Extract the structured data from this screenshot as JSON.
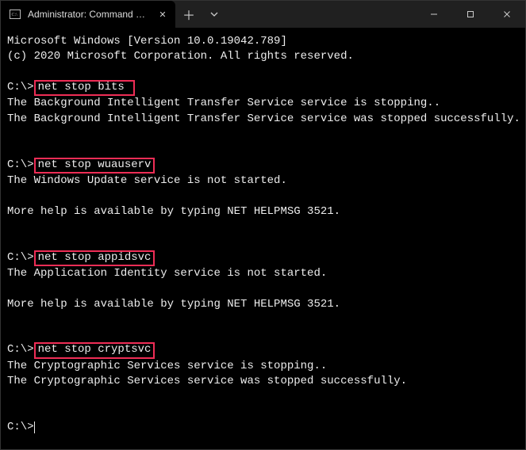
{
  "titlebar": {
    "tab_title": "Administrator: Command Promp",
    "tab_close_glyph": "✕",
    "new_tab_glyph": "＋",
    "dropdown_glyph": "⌄"
  },
  "win_controls": {
    "min_tooltip": "Minimize",
    "max_tooltip": "Maximize",
    "close_tooltip": "Close"
  },
  "terminal": {
    "line_os": "Microsoft Windows [Version 10.0.19042.789]",
    "line_copyright": "(c) 2020 Microsoft Corporation. All rights reserved.",
    "prompt": "C:\\>",
    "cmd1": "net stop bits",
    "cmd1_trail": " ",
    "out1a": "The Background Intelligent Transfer Service service is stopping..",
    "out1b": "The Background Intelligent Transfer Service service was stopped successfully.",
    "cmd2": "net stop wuauserv",
    "out2a": "The Windows Update service is not started.",
    "out2b": "More help is available by typing NET HELPMSG 3521.",
    "cmd3": "net stop appidsvc",
    "out3a": "The Application Identity service is not started.",
    "out3b": "More help is available by typing NET HELPMSG 3521.",
    "cmd4": "net stop cryptsvc",
    "out4a": "The Cryptographic Services service is stopping..",
    "out4b": "The Cryptographic Services service was stopped successfully."
  },
  "colors": {
    "highlight_border": "#ef2d56",
    "terminal_fg": "#ededed",
    "terminal_bg": "#000000",
    "titlebar_bg": "#202020"
  }
}
